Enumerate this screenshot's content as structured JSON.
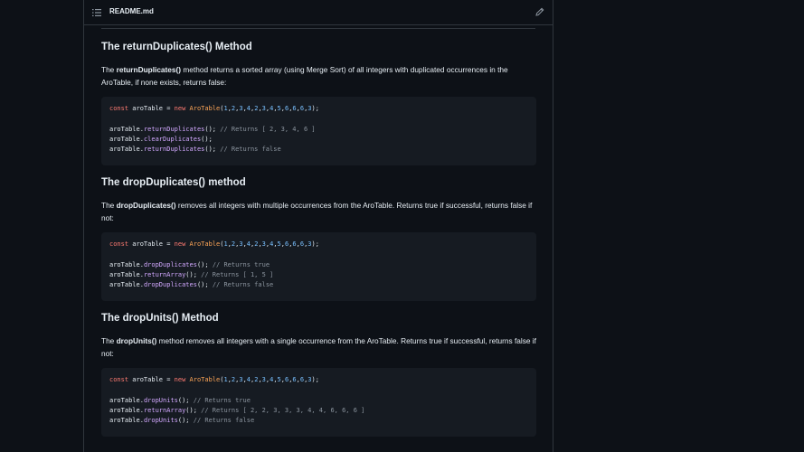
{
  "filebar": {
    "filename": "README.md",
    "list_icon": "list-icon",
    "edit_icon": "pencil-icon"
  },
  "sections": [
    {
      "heading": "The returnDuplicates() Method",
      "para_prefix": "The ",
      "para_bold": "returnDuplicates()",
      "para_rest": " method returns a sorted array (using Merge Sort) of all integers with duplicated occurrences in the AroTable, if none exists, returns false:",
      "code": {
        "decl": {
          "kw": "const",
          "var": " aroTable = ",
          "new": "new",
          "cls": "AroTable",
          "args": "1,2,3,4,2,3,4,5,6,6,6,3"
        },
        "calls": [
          {
            "obj": "aroTable.",
            "fn": "returnDuplicates",
            "rest": "(); ",
            "comment": "// Returns [ 2, 3, 4, 6 ]"
          },
          {
            "obj": "aroTable.",
            "fn": "clearDuplicates",
            "rest": "();",
            "comment": ""
          },
          {
            "obj": "aroTable.",
            "fn": "returnDuplicates",
            "rest": "(); ",
            "comment": "// Returns false"
          }
        ]
      }
    },
    {
      "heading": "The dropDuplicates() method",
      "para_prefix": "The ",
      "para_bold": "dropDuplicates()",
      "para_rest": " removes all integers with multiple occurrences from the AroTable. Returns true if successful, returns false if not:",
      "code": {
        "decl": {
          "kw": "const",
          "var": " aroTable = ",
          "new": "new",
          "cls": "AroTable",
          "args": "1,2,3,4,2,3,4,5,6,6,6,3"
        },
        "calls": [
          {
            "obj": "aroTable.",
            "fn": "dropDuplicates",
            "rest": "(); ",
            "comment": "// Returns true"
          },
          {
            "obj": "aroTable.",
            "fn": "returnArray",
            "rest": "(); ",
            "comment": "// Returns [ 1, 5 ]"
          },
          {
            "obj": "aroTable.",
            "fn": "dropDuplicates",
            "rest": "(); ",
            "comment": "// Returns false"
          }
        ]
      }
    },
    {
      "heading": "The dropUnits() Method",
      "para_prefix": "The ",
      "para_bold": "dropUnits()",
      "para_rest": " method removes all integers with a single occurrence from the AroTable. Returns true if successful, returns false if not:",
      "code": {
        "decl": {
          "kw": "const",
          "var": " aroTable = ",
          "new": "new",
          "cls": "AroTable",
          "args": "1,2,3,4,2,3,4,5,6,6,6,3"
        },
        "calls": [
          {
            "obj": "aroTable.",
            "fn": "dropUnits",
            "rest": "(); ",
            "comment": "// Returns true"
          },
          {
            "obj": "aroTable.",
            "fn": "returnArray",
            "rest": "(); ",
            "comment": "// Returns [ 2, 2, 3, 3, 3, 4, 4, 6, 6, 6 ]"
          },
          {
            "obj": "aroTable.",
            "fn": "dropUnits",
            "rest": "(); ",
            "comment": "// Returns false"
          }
        ]
      }
    }
  ],
  "colors": {
    "background": "#0d1117",
    "code_bg": "#161b22",
    "keyword": "#ff7b72",
    "class": "#ffa657",
    "number": "#79c0ff",
    "function": "#d2a8ff",
    "comment": "#8b949e"
  }
}
